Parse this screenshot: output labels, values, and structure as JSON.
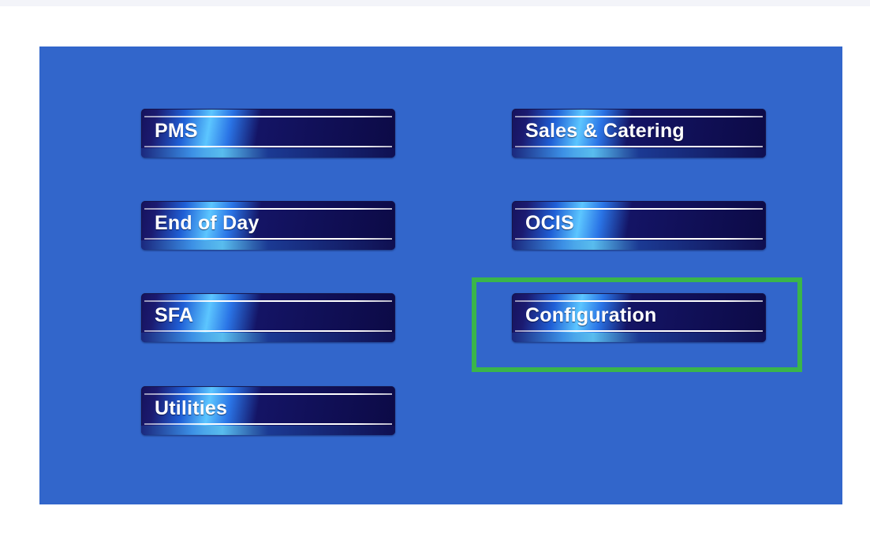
{
  "menu": {
    "buttons": [
      {
        "id": "pms",
        "label": "PMS"
      },
      {
        "id": "end-of-day",
        "label": "End of Day"
      },
      {
        "id": "sfa",
        "label": "SFA"
      },
      {
        "id": "utilities",
        "label": "Utilities"
      },
      {
        "id": "sales-catering",
        "label": "Sales & Catering"
      },
      {
        "id": "ocis",
        "label": "OCIS"
      },
      {
        "id": "configuration",
        "label": "Configuration"
      }
    ],
    "highlighted": "configuration"
  },
  "colors": {
    "panel_background": "#3266cb",
    "highlight_border": "#3ab54a",
    "button_text": "#ffffff"
  }
}
